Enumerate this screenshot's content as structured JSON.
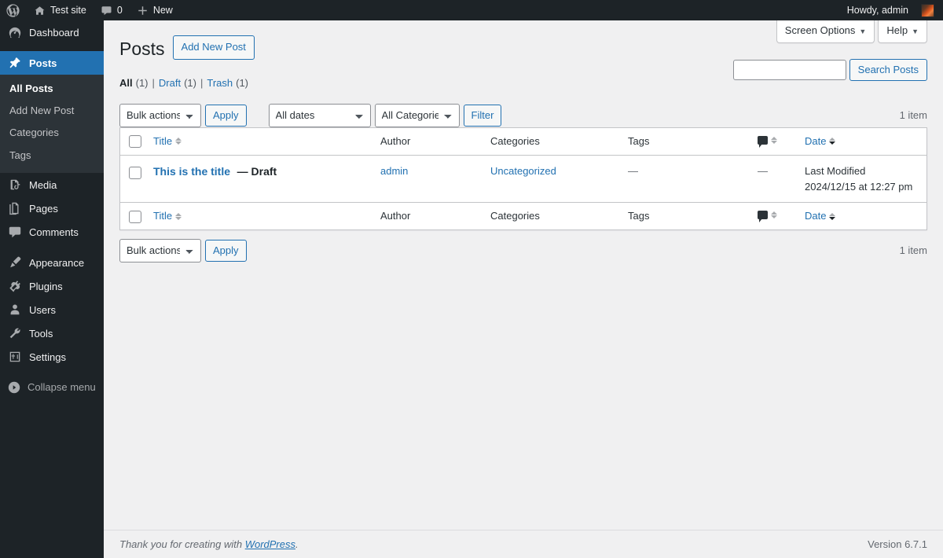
{
  "adminbar": {
    "logo_icon": "wordpress-logo-icon",
    "site_name": "Test site",
    "site_icon": "home-icon",
    "comments_icon": "comment-bubble-icon",
    "comments_count": "0",
    "new_icon": "plus-icon",
    "new_label": "New",
    "howdy": "Howdy, admin",
    "avatar_icon": "user-avatar"
  },
  "sidebar": {
    "items": [
      {
        "label": "Dashboard",
        "icon": "dashboard-icon",
        "current": false
      },
      {
        "label": "Posts",
        "icon": "pin-icon",
        "current": true
      },
      {
        "label": "Media",
        "icon": "media-icon",
        "current": false
      },
      {
        "label": "Pages",
        "icon": "pages-icon",
        "current": false
      },
      {
        "label": "Comments",
        "icon": "comments-icon",
        "current": false
      },
      {
        "label": "Appearance",
        "icon": "appearance-brush-icon",
        "current": false
      },
      {
        "label": "Plugins",
        "icon": "plugins-plug-icon",
        "current": false
      },
      {
        "label": "Users",
        "icon": "users-icon",
        "current": false
      },
      {
        "label": "Tools",
        "icon": "tools-wrench-icon",
        "current": false
      },
      {
        "label": "Settings",
        "icon": "settings-sliders-icon",
        "current": false
      }
    ],
    "submenu": [
      {
        "label": "All Posts",
        "current": true
      },
      {
        "label": "Add New Post",
        "current": false
      },
      {
        "label": "Categories",
        "current": false
      },
      {
        "label": "Tags",
        "current": false
      }
    ],
    "collapse": {
      "label": "Collapse menu",
      "icon": "collapse-arrow-icon"
    }
  },
  "screen_meta": {
    "screen_options": "Screen Options",
    "help": "Help",
    "caret_icon": "chevron-down-icon"
  },
  "page": {
    "title": "Posts",
    "add_new_label": "Add New Post"
  },
  "views": {
    "all": {
      "label": "All",
      "count": "(1)"
    },
    "draft": {
      "label": "Draft",
      "count": "(1)"
    },
    "trash": {
      "label": "Trash",
      "count": "(1)"
    },
    "divider": "|"
  },
  "search": {
    "value": "",
    "placeholder": "",
    "button_label": "Search Posts"
  },
  "tablenav_top": {
    "bulk_actions_label": "Bulk actions",
    "apply_label": "Apply",
    "dates_label": "All dates",
    "categories_label": "All Categories",
    "filter_label": "Filter",
    "displaying_num": "1 item"
  },
  "tablenav_bottom": {
    "bulk_actions_label": "Bulk actions",
    "apply_label": "Apply",
    "displaying_num": "1 item"
  },
  "table": {
    "columns": {
      "title": "Title",
      "author": "Author",
      "categories": "Categories",
      "tags": "Tags",
      "comments_icon": "comment-bubble-icon",
      "date": "Date"
    },
    "rows": [
      {
        "title": "This is the title",
        "state": "— Draft",
        "author": "admin",
        "categories": "Uncategorized",
        "tags": "—",
        "comments": "—",
        "date_label": "Last Modified",
        "date_value": "2024/12/15 at 12:27 pm"
      }
    ]
  },
  "footer": {
    "thanks_prefix": "Thank you for creating with ",
    "thanks_link": "WordPress",
    "thanks_suffix": ".",
    "version": "Version 6.7.1"
  },
  "colors": {
    "admin_dark": "#1d2327",
    "submenu_bg": "#2c3338",
    "accent_blue": "#2271b1",
    "page_bg": "#f0f0f1",
    "border": "#c3c4c7"
  }
}
